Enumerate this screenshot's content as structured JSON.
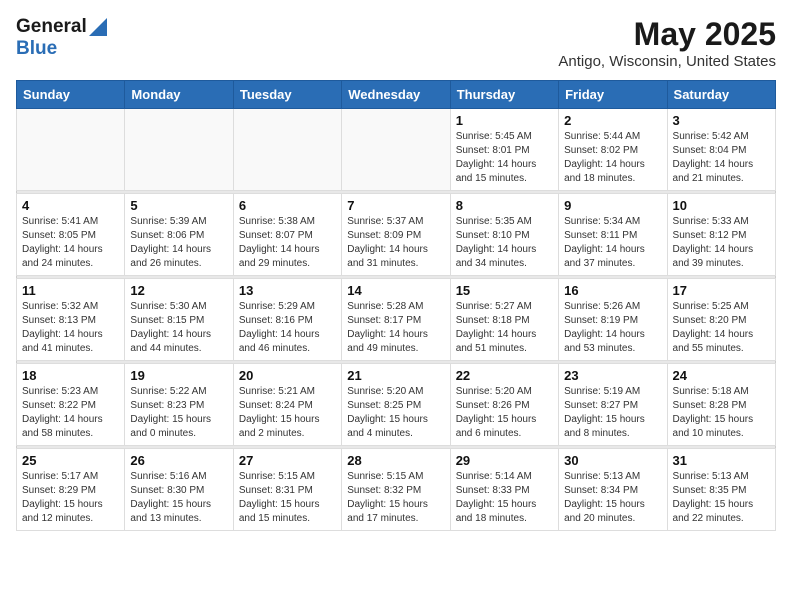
{
  "logo": {
    "general": "General",
    "blue": "Blue"
  },
  "title": "May 2025",
  "subtitle": "Antigo, Wisconsin, United States",
  "days_of_week": [
    "Sunday",
    "Monday",
    "Tuesday",
    "Wednesday",
    "Thursday",
    "Friday",
    "Saturday"
  ],
  "weeks": [
    [
      {
        "day": "",
        "info": ""
      },
      {
        "day": "",
        "info": ""
      },
      {
        "day": "",
        "info": ""
      },
      {
        "day": "",
        "info": ""
      },
      {
        "day": "1",
        "info": "Sunrise: 5:45 AM\nSunset: 8:01 PM\nDaylight: 14 hours and 15 minutes."
      },
      {
        "day": "2",
        "info": "Sunrise: 5:44 AM\nSunset: 8:02 PM\nDaylight: 14 hours and 18 minutes."
      },
      {
        "day": "3",
        "info": "Sunrise: 5:42 AM\nSunset: 8:04 PM\nDaylight: 14 hours and 21 minutes."
      }
    ],
    [
      {
        "day": "4",
        "info": "Sunrise: 5:41 AM\nSunset: 8:05 PM\nDaylight: 14 hours and 24 minutes."
      },
      {
        "day": "5",
        "info": "Sunrise: 5:39 AM\nSunset: 8:06 PM\nDaylight: 14 hours and 26 minutes."
      },
      {
        "day": "6",
        "info": "Sunrise: 5:38 AM\nSunset: 8:07 PM\nDaylight: 14 hours and 29 minutes."
      },
      {
        "day": "7",
        "info": "Sunrise: 5:37 AM\nSunset: 8:09 PM\nDaylight: 14 hours and 31 minutes."
      },
      {
        "day": "8",
        "info": "Sunrise: 5:35 AM\nSunset: 8:10 PM\nDaylight: 14 hours and 34 minutes."
      },
      {
        "day": "9",
        "info": "Sunrise: 5:34 AM\nSunset: 8:11 PM\nDaylight: 14 hours and 37 minutes."
      },
      {
        "day": "10",
        "info": "Sunrise: 5:33 AM\nSunset: 8:12 PM\nDaylight: 14 hours and 39 minutes."
      }
    ],
    [
      {
        "day": "11",
        "info": "Sunrise: 5:32 AM\nSunset: 8:13 PM\nDaylight: 14 hours and 41 minutes."
      },
      {
        "day": "12",
        "info": "Sunrise: 5:30 AM\nSunset: 8:15 PM\nDaylight: 14 hours and 44 minutes."
      },
      {
        "day": "13",
        "info": "Sunrise: 5:29 AM\nSunset: 8:16 PM\nDaylight: 14 hours and 46 minutes."
      },
      {
        "day": "14",
        "info": "Sunrise: 5:28 AM\nSunset: 8:17 PM\nDaylight: 14 hours and 49 minutes."
      },
      {
        "day": "15",
        "info": "Sunrise: 5:27 AM\nSunset: 8:18 PM\nDaylight: 14 hours and 51 minutes."
      },
      {
        "day": "16",
        "info": "Sunrise: 5:26 AM\nSunset: 8:19 PM\nDaylight: 14 hours and 53 minutes."
      },
      {
        "day": "17",
        "info": "Sunrise: 5:25 AM\nSunset: 8:20 PM\nDaylight: 14 hours and 55 minutes."
      }
    ],
    [
      {
        "day": "18",
        "info": "Sunrise: 5:23 AM\nSunset: 8:22 PM\nDaylight: 14 hours and 58 minutes."
      },
      {
        "day": "19",
        "info": "Sunrise: 5:22 AM\nSunset: 8:23 PM\nDaylight: 15 hours and 0 minutes."
      },
      {
        "day": "20",
        "info": "Sunrise: 5:21 AM\nSunset: 8:24 PM\nDaylight: 15 hours and 2 minutes."
      },
      {
        "day": "21",
        "info": "Sunrise: 5:20 AM\nSunset: 8:25 PM\nDaylight: 15 hours and 4 minutes."
      },
      {
        "day": "22",
        "info": "Sunrise: 5:20 AM\nSunset: 8:26 PM\nDaylight: 15 hours and 6 minutes."
      },
      {
        "day": "23",
        "info": "Sunrise: 5:19 AM\nSunset: 8:27 PM\nDaylight: 15 hours and 8 minutes."
      },
      {
        "day": "24",
        "info": "Sunrise: 5:18 AM\nSunset: 8:28 PM\nDaylight: 15 hours and 10 minutes."
      }
    ],
    [
      {
        "day": "25",
        "info": "Sunrise: 5:17 AM\nSunset: 8:29 PM\nDaylight: 15 hours and 12 minutes."
      },
      {
        "day": "26",
        "info": "Sunrise: 5:16 AM\nSunset: 8:30 PM\nDaylight: 15 hours and 13 minutes."
      },
      {
        "day": "27",
        "info": "Sunrise: 5:15 AM\nSunset: 8:31 PM\nDaylight: 15 hours and 15 minutes."
      },
      {
        "day": "28",
        "info": "Sunrise: 5:15 AM\nSunset: 8:32 PM\nDaylight: 15 hours and 17 minutes."
      },
      {
        "day": "29",
        "info": "Sunrise: 5:14 AM\nSunset: 8:33 PM\nDaylight: 15 hours and 18 minutes."
      },
      {
        "day": "30",
        "info": "Sunrise: 5:13 AM\nSunset: 8:34 PM\nDaylight: 15 hours and 20 minutes."
      },
      {
        "day": "31",
        "info": "Sunrise: 5:13 AM\nSunset: 8:35 PM\nDaylight: 15 hours and 22 minutes."
      }
    ]
  ]
}
